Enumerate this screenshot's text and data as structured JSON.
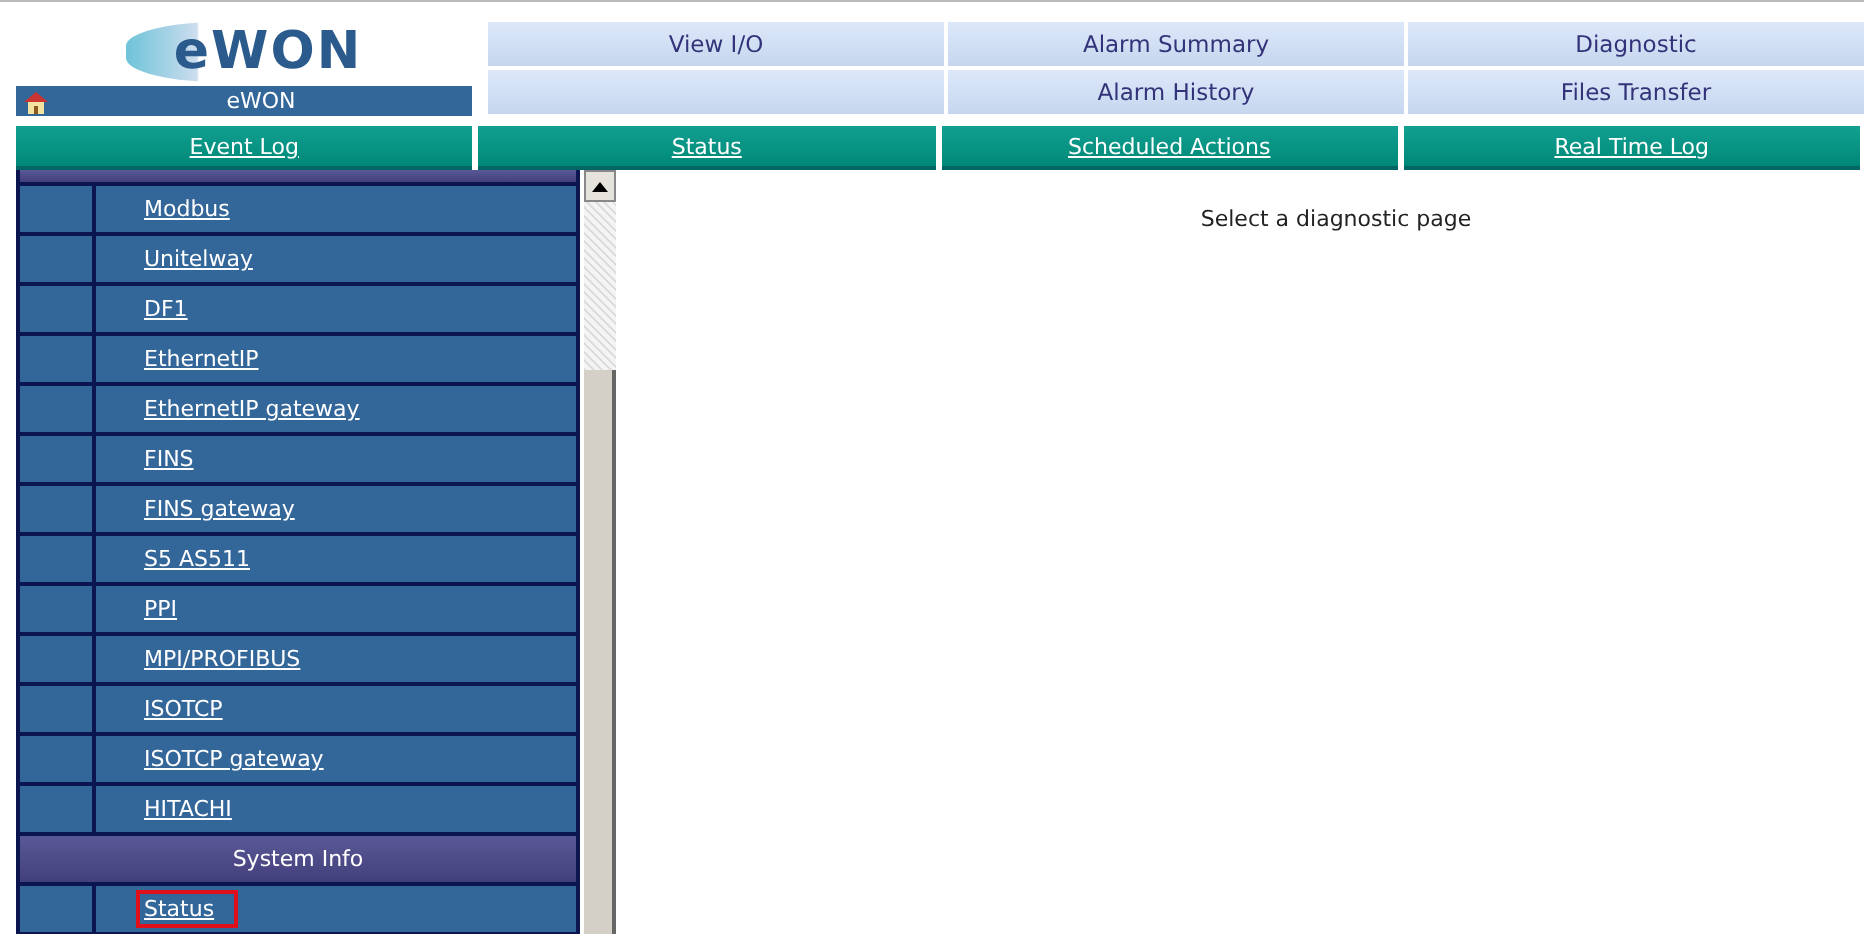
{
  "header": {
    "logo_text": "eWON",
    "device_name": "eWON"
  },
  "top_nav": [
    {
      "kind": "link",
      "label": "View I/O"
    },
    {
      "kind": "link",
      "label": "Alarm Summary"
    },
    {
      "kind": "link",
      "label": "Diagnostic"
    },
    {
      "kind": "blank"
    },
    {
      "kind": "link",
      "label": "Alarm History"
    },
    {
      "kind": "link",
      "label": "Files Transfer"
    }
  ],
  "tabs": [
    {
      "label": "Event Log",
      "selected": false
    },
    {
      "label": "Status",
      "selected": false
    },
    {
      "label": "Scheduled Actions",
      "selected": false
    },
    {
      "label": "Real Time Log",
      "selected": false
    }
  ],
  "sidebar": {
    "items": [
      {
        "kind": "header"
      },
      {
        "kind": "link",
        "label": "Modbus",
        "highlighted": false
      },
      {
        "kind": "link",
        "label": "Unitelway",
        "highlighted": false
      },
      {
        "kind": "link",
        "label": "DF1",
        "highlighted": false
      },
      {
        "kind": "link",
        "label": "EthernetIP",
        "highlighted": false
      },
      {
        "kind": "link",
        "label": "EthernetIP gateway",
        "highlighted": false
      },
      {
        "kind": "link",
        "label": "FINS",
        "highlighted": false
      },
      {
        "kind": "link",
        "label": "FINS gateway",
        "highlighted": false
      },
      {
        "kind": "link",
        "label": "S5 AS511",
        "highlighted": false
      },
      {
        "kind": "link",
        "label": "PPI",
        "highlighted": false
      },
      {
        "kind": "link",
        "label": "MPI/PROFIBUS",
        "highlighted": false
      },
      {
        "kind": "link",
        "label": "ISOTCP",
        "highlighted": false
      },
      {
        "kind": "link",
        "label": "ISOTCP gateway",
        "highlighted": false
      },
      {
        "kind": "link",
        "label": "HITACHI",
        "highlighted": false
      },
      {
        "kind": "header",
        "label": "System Info"
      },
      {
        "kind": "link",
        "label": "Status",
        "highlighted": true
      }
    ]
  },
  "content": {
    "message": "Select a diagnostic page"
  }
}
